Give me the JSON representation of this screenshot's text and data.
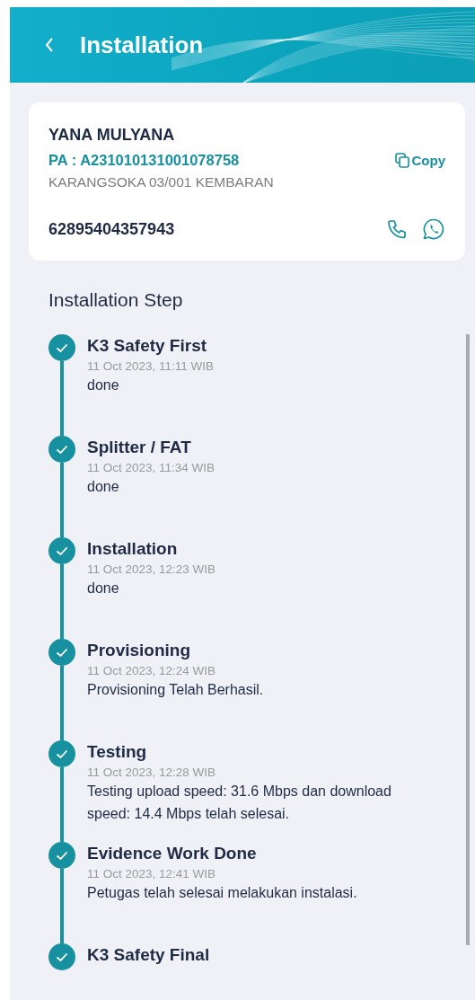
{
  "header": {
    "title": "Installation"
  },
  "customer": {
    "name": "YANA MULYANA",
    "pa": "PA : A231010131001078758",
    "copy_label": "Copy",
    "address": "KARANGSOKA 03/001 KEMBARAN",
    "phone": "62895404357943"
  },
  "steps_title": "Installation Step",
  "steps": [
    {
      "title": "K3 Safety First",
      "time": "11 Oct 2023, 11:11 WIB",
      "note": "done",
      "done": true
    },
    {
      "title": "Splitter / FAT",
      "time": "11 Oct 2023, 11:34 WIB",
      "note": "done",
      "done": true
    },
    {
      "title": "Installation",
      "time": "11 Oct 2023, 12:23 WIB",
      "note": "done",
      "done": true
    },
    {
      "title": "Provisioning",
      "time": "11 Oct 2023, 12:24 WIB",
      "note": "Provisioning Telah Berhasil.",
      "done": true
    },
    {
      "title": "Testing",
      "time": "11 Oct 2023, 12:28 WIB",
      "note": "Testing upload speed: 31.6 Mbps dan download speed: 14.4 Mbps telah selesai.",
      "done": true
    },
    {
      "title": "Evidence Work Done",
      "time": "11 Oct 2023, 12:41 WIB",
      "note": "Petugas telah selesai melakukan instalasi.",
      "done": true
    },
    {
      "title": "K3 Safety Final",
      "done": true
    }
  ]
}
